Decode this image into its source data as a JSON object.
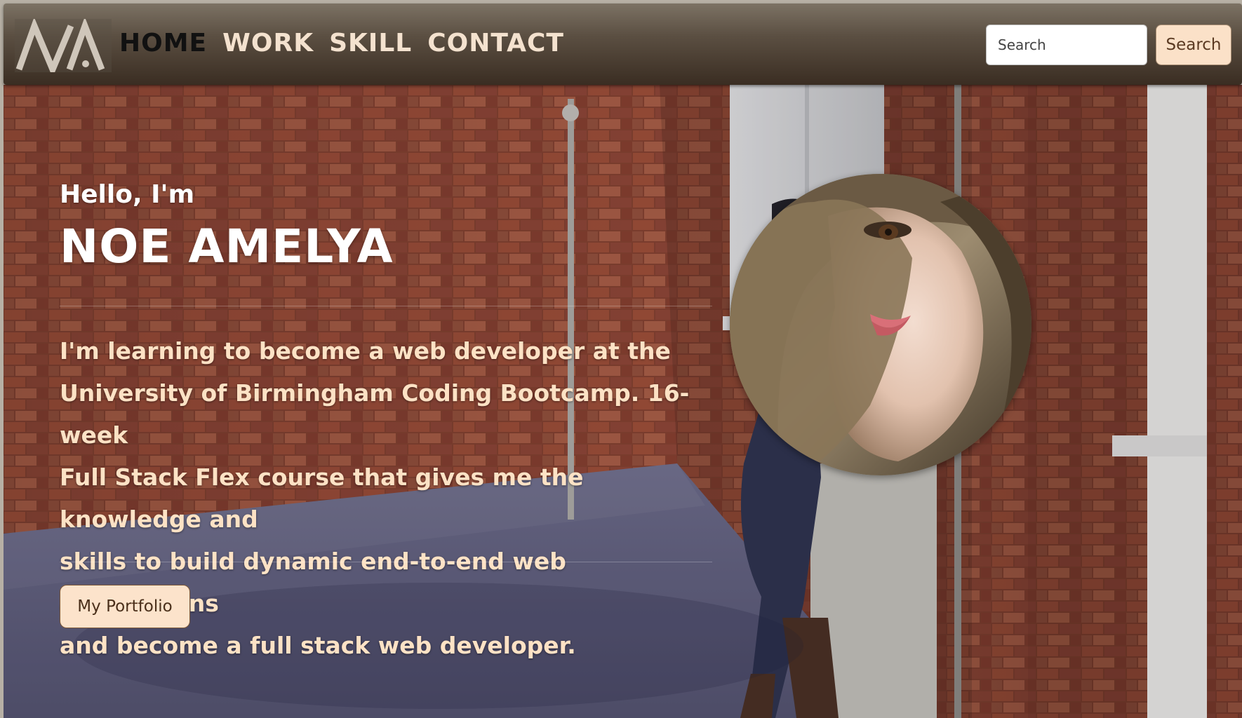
{
  "nav": {
    "links": [
      {
        "label": "HOME",
        "active": true
      },
      {
        "label": "WORK",
        "active": false
      },
      {
        "label": "SKILL",
        "active": false
      },
      {
        "label": "CONTACT",
        "active": false
      }
    ],
    "search_placeholder": "Search",
    "search_button": "Search"
  },
  "hero": {
    "greeting": "Hello, I'm",
    "name": "NOE AMELYA",
    "intro_lines": [
      "I'm learning to become a web developer at the",
      "University of Birmingham Coding Bootcamp. 16-week",
      "Full Stack Flex course that gives me the knowledge and",
      "skills to build dynamic end-to-end web applications",
      "and become a full stack web developer."
    ],
    "portfolio_button": "My Portfolio"
  },
  "colors": {
    "nav_text": "#f4e2cf",
    "nav_active": "#111111",
    "button_bg": "#fce3cb",
    "intro_text": "#fde2c5"
  }
}
